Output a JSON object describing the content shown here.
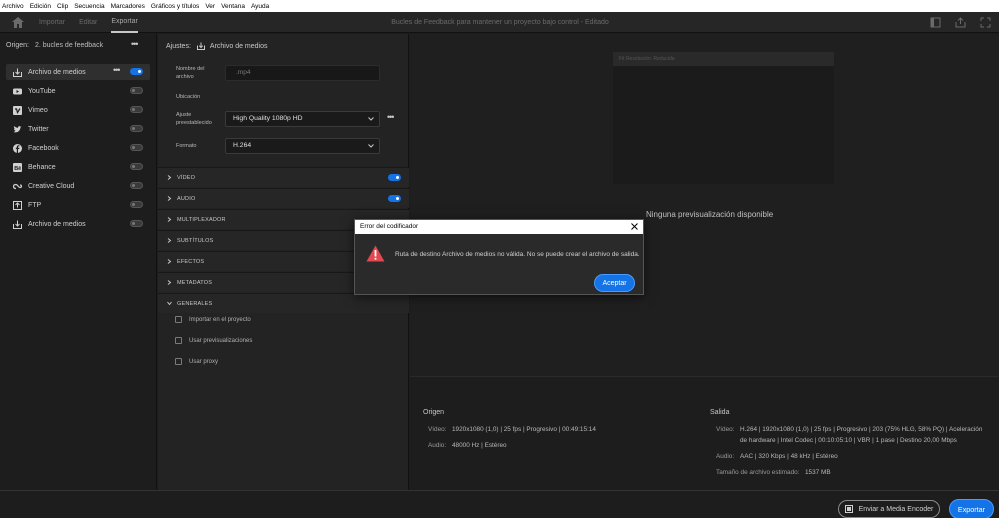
{
  "menubar": [
    "Archivo",
    "Edición",
    "Clip",
    "Secuencia",
    "Marcadores",
    "Gráficos y títulos",
    "Ver",
    "Ventana",
    "Ayuda"
  ],
  "tabs": {
    "import": "Importar",
    "edit": "Editar",
    "export": "Exportar"
  },
  "window_title": "Bucles de Feedback para mantener un proyecto bajo control - Editado",
  "left": {
    "origin_label": "Origen:",
    "origin_value": "2. bucles de feedback",
    "destinations": [
      {
        "label": "Archivo de medios",
        "icon": "export-icon",
        "on": true
      },
      {
        "label": "YouTube",
        "icon": "youtube-icon",
        "on": false
      },
      {
        "label": "Vimeo",
        "icon": "vimeo-icon",
        "on": false
      },
      {
        "label": "Twitter",
        "icon": "twitter-icon",
        "on": false
      },
      {
        "label": "Facebook",
        "icon": "facebook-icon",
        "on": false
      },
      {
        "label": "Behance",
        "icon": "behance-icon",
        "on": false
      },
      {
        "label": "Creative Cloud",
        "icon": "creative-cloud-icon",
        "on": false
      },
      {
        "label": "FTP",
        "icon": "ftp-icon",
        "on": false
      },
      {
        "label": "Archivo de medios",
        "icon": "export-icon",
        "on": false
      }
    ]
  },
  "settings": {
    "ajustes_label": "Ajustes:",
    "ajustes_value": "Archivo de medios",
    "name_label_1": "Nombre del",
    "name_label_2": "archivo",
    "name_value": ".mp4",
    "location_label": "Ubicación",
    "preset_label_1": "Ajuste",
    "preset_label_2": "preestablecido",
    "preset_value": "High Quality 1080p HD",
    "format_label": "Formato",
    "format_value": "H.264",
    "sections": [
      {
        "title": "VÍDEO",
        "toggle": true
      },
      {
        "title": "AUDIO",
        "toggle": true
      },
      {
        "title": "MULTIPLEXADOR"
      },
      {
        "title": "SUBTÍTULOS"
      },
      {
        "title": "EFECTOS"
      },
      {
        "title": "METADATOS"
      },
      {
        "title": "GENERALES"
      }
    ],
    "checkboxes": [
      "Importar en el proyecto",
      "Usar previsualizaciones",
      "Usar proxy"
    ]
  },
  "preview": {
    "top_bar": "Fit   Resolución: Reducida",
    "no_preview": "Ninguna previsualización disponible"
  },
  "info": {
    "origin_heading": "Origen",
    "origin_video_label": "Vídeo:",
    "origin_video": "1920x1080 (1,0)  |  25 fps  |  Progresivo  |  00:49:15:14",
    "origin_audio_label": "Audio:",
    "origin_audio": "48000 Hz  |  Estéreo",
    "output_heading": "Salida",
    "output_video_label": "Vídeo:",
    "output_video_1": "H.264  |  1920x1080 (1,0)  |  25 fps  |  Progresivo  |  203 (75% HLG, 58% PQ)  |  Aceleración",
    "output_video_2": "de hardware  |  Intel Codec  |  00:10:05:10  |  VBR  |  1 pase  |  Destino 20,00 Mbps",
    "output_audio_label": "Audio:",
    "output_audio": "AAC  |  320 Kbps  |  48 kHz  |  Estéreo",
    "filesize_label": "Tamaño de archivo estimado:",
    "filesize": "1537 MB"
  },
  "bottom": {
    "media_encoder": "Enviar a Media Encoder",
    "export": "Exportar"
  },
  "dialog": {
    "title": "Error del codificador",
    "message": "Ruta de destino Archivo de medios no válida. No se puede crear el archivo de salida.",
    "ok": "Aceptar"
  },
  "colors": {
    "accent": "#1473e6",
    "warning": "#e34850"
  }
}
